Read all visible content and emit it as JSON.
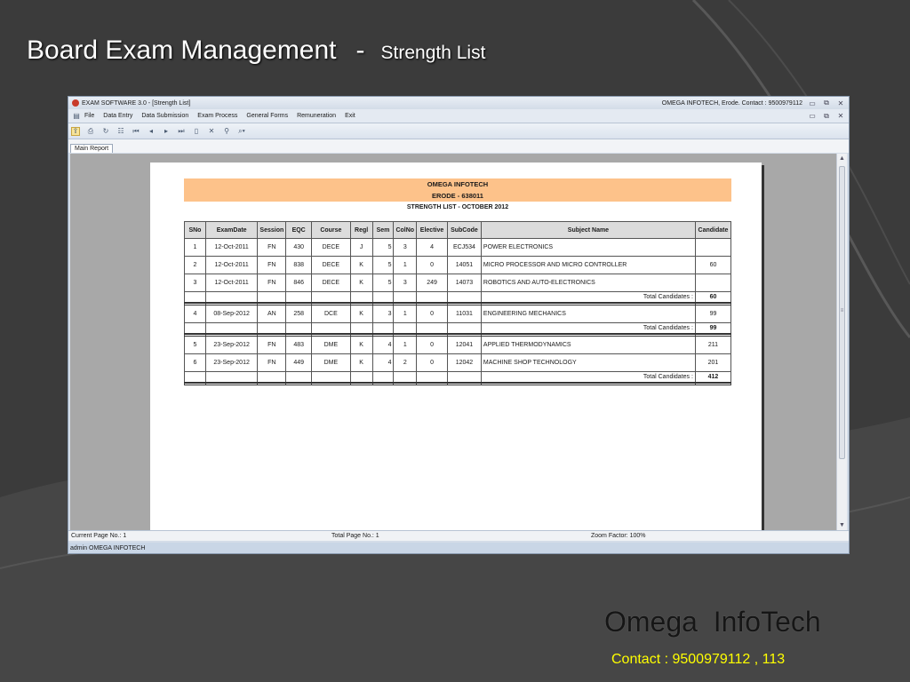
{
  "slide": {
    "title": "Board Exam Management",
    "dash": "-",
    "subtitle": "Strength List",
    "brand": "Omega  InfoTech",
    "contact": "Contact : 9500979112 , 113"
  },
  "window": {
    "title": "EXAM SOFTWARE 3.0 - [Strength List]",
    "company_contact": "OMEGA INFOTECH, Erode. Contact : 9500979112",
    "min_icon": "minimize-icon",
    "max_icon": "restore-icon",
    "close_icon": "close-icon"
  },
  "menu": {
    "items": [
      "File",
      "Data Entry",
      "Data Submission",
      "Exam Process",
      "General Forms",
      "Remuneration",
      "Exit"
    ]
  },
  "toolbar": {
    "icons": [
      "export-icon",
      "print-icon",
      "refresh-icon",
      "tree-icon",
      "first-page-icon",
      "prev-page-icon",
      "next-page-icon",
      "last-page-icon",
      "goto-page-icon",
      "close-report-icon",
      "search-icon",
      "zoom-icon"
    ]
  },
  "tabs": {
    "main_report": "Main Report"
  },
  "report": {
    "company": "OMEGA INFOTECH",
    "city": "ERODE - 638011",
    "subtitle": "STRENGTH LIST - OCTOBER 2012",
    "columns": [
      "SNo",
      "ExamDate",
      "Session",
      "EQC",
      "Course",
      "Regl",
      "Sem",
      "ColNo",
      "Elective",
      "SubCode",
      "Subject Name",
      "Candidate"
    ],
    "total_label": "Total Candidates :",
    "groups": [
      {
        "rows": [
          [
            "1",
            "12-Oct-2011",
            "FN",
            "430",
            "DECE",
            "J",
            "5",
            "3",
            "4",
            "ECJ534",
            "POWER ELECTRONICS",
            ""
          ],
          [
            "2",
            "12-Oct-2011",
            "FN",
            "838",
            "DECE",
            "K",
            "5",
            "1",
            "0",
            "14051",
            "MICRO PROCESSOR AND MICRO CONTROLLER",
            "60"
          ],
          [
            "3",
            "12-Oct-2011",
            "FN",
            "846",
            "DECE",
            "K",
            "5",
            "3",
            "249",
            "14073",
            "ROBOTICS AND AUTO-ELECTRONICS",
            ""
          ]
        ],
        "total": "60"
      },
      {
        "rows": [
          [
            "4",
            "08-Sep-2012",
            "AN",
            "258",
            "DCE",
            "K",
            "3",
            "1",
            "0",
            "11031",
            "ENGINEERING MECHANICS",
            "99"
          ]
        ],
        "total": "99"
      },
      {
        "rows": [
          [
            "5",
            "23-Sep-2012",
            "FN",
            "483",
            "DME",
            "K",
            "4",
            "1",
            "0",
            "12041",
            "APPLIED THERMODYNAMICS",
            "211"
          ],
          [
            "6",
            "23-Sep-2012",
            "FN",
            "449",
            "DME",
            "K",
            "4",
            "2",
            "0",
            "12042",
            "MACHINE SHOP TECHNOLOGY",
            "201"
          ]
        ],
        "total": "412"
      }
    ]
  },
  "status": {
    "current_page": "Current Page No.: 1",
    "total_page": "Total Page No.: 1",
    "zoom": "Zoom Factor: 100%"
  },
  "user": {
    "info": "admin  OMEGA INFOTECH"
  },
  "colors": {
    "report_header": "#fdc28a",
    "contact_text": "#ffff00"
  }
}
